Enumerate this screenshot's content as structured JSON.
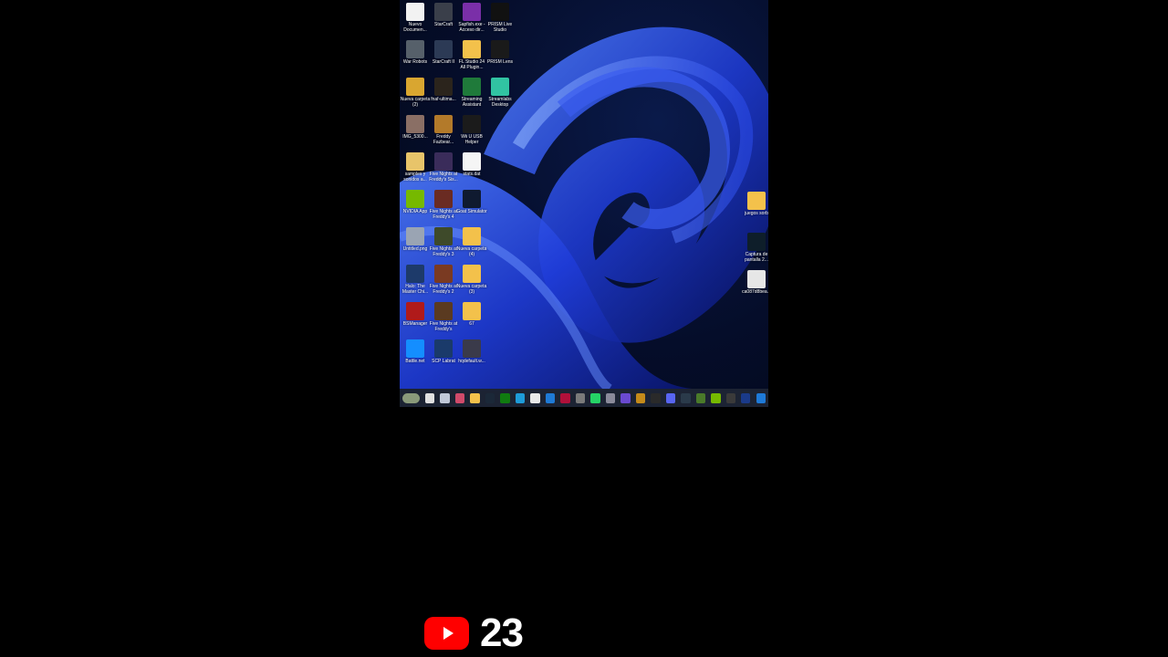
{
  "desktop": {
    "left_icons": [
      {
        "label": "Nuevo Documen...",
        "icon": "document-icon",
        "color": "#f2f2f2"
      },
      {
        "label": "StarCraft",
        "icon": "starcraft-icon",
        "color": "#3a3f4a"
      },
      {
        "label": "Sapfish.exe - Acceso dir...",
        "icon": "sapfish-icon",
        "color": "#7a2fa8"
      },
      {
        "label": "PRISM Live Studio",
        "icon": "prism-live-icon",
        "color": "#111111"
      },
      {
        "label": "War Robots",
        "icon": "war-robots-icon",
        "color": "#56606a"
      },
      {
        "label": "StarCraft II",
        "icon": "starcraft2-icon",
        "color": "#2c3a55"
      },
      {
        "label": "FL Studio 24 All Plugin...",
        "icon": "folder-icon",
        "color": "#f3c14b"
      },
      {
        "label": "PRISM Lens",
        "icon": "prism-lens-icon",
        "color": "#1a1a1a"
      },
      {
        "label": "Nueva carpeta (2)",
        "icon": "folder-icon",
        "color": "#d9a630"
      },
      {
        "label": "fnaf-ultima...",
        "icon": "fnaf-icon",
        "color": "#2b241c"
      },
      {
        "label": "Streaming Assistant",
        "icon": "streaming-assistant-icon",
        "color": "#1f7a3a"
      },
      {
        "label": "Streamlabs Desktop",
        "icon": "streamlabs-icon",
        "color": "#31c3a2"
      },
      {
        "label": "IMG_5300...",
        "icon": "image-icon",
        "color": "#8a6f65"
      },
      {
        "label": "Freddy Fazbear...",
        "icon": "freddy-icon",
        "color": "#b37a2a"
      },
      {
        "label": "Wii U USB Helper",
        "icon": "wiiu-icon",
        "color": "#1b1b1b"
      },
      {
        "label": "",
        "icon": "empty",
        "color": "transparent"
      },
      {
        "label": "samples y sonidos a...",
        "icon": "folder-icon",
        "color": "#e8c46a"
      },
      {
        "label": "Five Nights at Freddy's Sis...",
        "icon": "fnaf-sl-icon",
        "color": "#3a2c5a"
      },
      {
        "label": "stats.dat",
        "icon": "file-icon",
        "color": "#f5f5f5"
      },
      {
        "label": "",
        "icon": "empty",
        "color": "transparent"
      },
      {
        "label": "NVIDIA App",
        "icon": "nvidia-icon",
        "color": "#76b900"
      },
      {
        "label": "Five Nights at Freddy's 4",
        "icon": "fnaf4-icon",
        "color": "#6a2b22"
      },
      {
        "label": "Goat Simulator",
        "icon": "goat-icon",
        "color": "#0f1a30"
      },
      {
        "label": "",
        "icon": "empty",
        "color": "transparent"
      },
      {
        "label": "Untitled.png",
        "icon": "png-icon",
        "color": "#9aa4b3"
      },
      {
        "label": "Five Nights at Freddy's 3",
        "icon": "fnaf3-icon",
        "color": "#3e4a2a"
      },
      {
        "label": "Nueva carpeta (4)",
        "icon": "folder-icon",
        "color": "#f3c14b"
      },
      {
        "label": "",
        "icon": "empty",
        "color": "transparent"
      },
      {
        "label": "Halo: The Master Chi...",
        "icon": "halo-icon",
        "color": "#1d3a6a"
      },
      {
        "label": "Five Nights at Freddy's 2",
        "icon": "fnaf2-icon",
        "color": "#7a3a22"
      },
      {
        "label": "Nueva carpeta (3)",
        "icon": "folder-icon",
        "color": "#f3c14b"
      },
      {
        "label": "",
        "icon": "empty",
        "color": "transparent"
      },
      {
        "label": "BSManager",
        "icon": "bsmanager-icon",
        "color": "#b01a1a"
      },
      {
        "label": "Five Nights at Freddy's",
        "icon": "fnaf1-icon",
        "color": "#5a3a20"
      },
      {
        "label": "67",
        "icon": "folder-icon",
        "color": "#f3c14b"
      },
      {
        "label": "",
        "icon": "empty",
        "color": "transparent"
      },
      {
        "label": "Battle.net",
        "icon": "battlenet-icon",
        "color": "#148eff"
      },
      {
        "label": "SCP Labrat",
        "icon": "scp-labrat-icon",
        "color": "#1a3a6a"
      },
      {
        "label": "hqdefault.w...",
        "icon": "image-icon",
        "color": "#3a3a4a"
      }
    ],
    "right_icons": [
      {
        "label": "juegos sorb",
        "icon": "folder-icon",
        "color": "#f3c14b"
      },
      {
        "label": "Captura de pantalla 2...",
        "icon": "screenshot-icon",
        "color": "#0e1e2a"
      },
      {
        "label": "ca087d8bea...",
        "icon": "image-icon",
        "color": "#e6e6e6"
      }
    ]
  },
  "taskbar": {
    "items": [
      {
        "icon": "weather-widget-icon",
        "color": "#8a9a7a"
      },
      {
        "icon": "start-icon",
        "color": "#e0e0e0"
      },
      {
        "icon": "search-icon",
        "color": "#c0c8d8"
      },
      {
        "icon": "copilot-icon",
        "color": "#d04a6a"
      },
      {
        "icon": "file-explorer-icon",
        "color": "#f3c14b"
      },
      {
        "icon": "steam-icon",
        "color": "#1b2838"
      },
      {
        "icon": "xbox-icon",
        "color": "#107c10"
      },
      {
        "icon": "edge-icon",
        "color": "#1e9bd8"
      },
      {
        "icon": "store-icon",
        "color": "#e8e8e8"
      },
      {
        "icon": "mail-icon",
        "color": "#1f7ad6"
      },
      {
        "icon": "recorder-icon",
        "color": "#b0103a"
      },
      {
        "icon": "settings-icon",
        "color": "#7a7a7a"
      },
      {
        "icon": "whatsapp-icon",
        "color": "#25d366"
      },
      {
        "icon": "photos-icon",
        "color": "#8a8a9a"
      },
      {
        "icon": "app-icon",
        "color": "#6a4ad0"
      },
      {
        "icon": "app2-icon",
        "color": "#c48a1a"
      },
      {
        "icon": "terminal-icon",
        "color": "#2a2a2a"
      },
      {
        "icon": "discord-icon",
        "color": "#5865f2"
      },
      {
        "icon": "capture-icon",
        "color": "#2a3a4a"
      },
      {
        "icon": "minecraft-icon",
        "color": "#4a7a2a"
      },
      {
        "icon": "nvidia-icon",
        "color": "#76b900"
      },
      {
        "icon": "obs-icon",
        "color": "#3a3a3a"
      },
      {
        "icon": "media-icon",
        "color": "#1a3a8a"
      },
      {
        "icon": "network-icon",
        "color": "#1e7ad8"
      }
    ]
  },
  "overlay": {
    "platform_icon": "youtube-icon",
    "number": "23"
  }
}
